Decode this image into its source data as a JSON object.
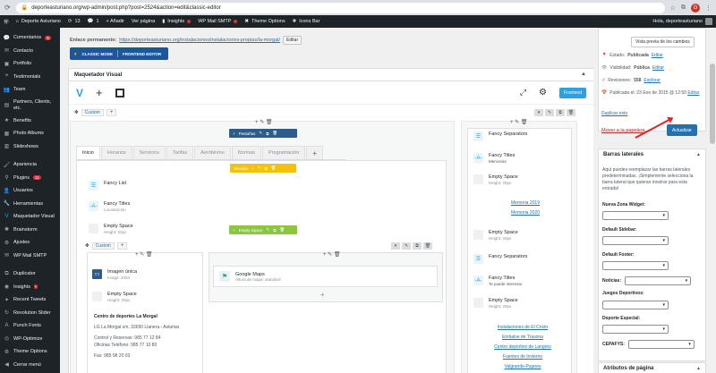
{
  "browser": {
    "url": "deporteasturiano.org/wp-admin/post.php?post=2524&action=edit&classic-editor",
    "avatar_letter": "G"
  },
  "adminbar": {
    "site": "Deporte Asturiano",
    "comments_count": "13",
    "messages_count": "1",
    "new_label": "+ Añadir",
    "view_label": "Ver página",
    "insights_label": "Insights",
    "smtp_label": "WP Mail SMTP",
    "theme_options": "Theme Options",
    "icons_bar": "Icons Bar",
    "hello": "Hola, deporteasturiano"
  },
  "sidebar": {
    "items": [
      {
        "label": "Comentarios",
        "icon": "comment-icon",
        "badge": "9"
      },
      {
        "label": "Contacto",
        "icon": "mail-icon"
      },
      {
        "label": "Portfolio",
        "icon": "portfolio-icon"
      },
      {
        "label": "Testimonials",
        "icon": "quote-icon"
      },
      {
        "label": "Team",
        "icon": "team-icon"
      },
      {
        "label": "Partners, Clients, etc.",
        "icon": "partners-icon"
      },
      {
        "label": "Benefits",
        "icon": "benefits-icon"
      },
      {
        "label": "Photo Albums",
        "icon": "photo-icon"
      },
      {
        "label": "Slideshows",
        "icon": "slides-icon"
      },
      {
        "label": "Apariencia",
        "icon": "brush-icon"
      },
      {
        "label": "Plugins",
        "icon": "plugin-icon",
        "badge": "11"
      },
      {
        "label": "Usuarios",
        "icon": "user-icon"
      },
      {
        "label": "Herramientas",
        "icon": "tools-icon"
      },
      {
        "label": "Maquetador Visual",
        "icon": "vc-icon"
      },
      {
        "label": "Brainstorm",
        "icon": "brain-icon"
      },
      {
        "label": "Ajustes",
        "icon": "settings-icon"
      },
      {
        "label": "WP Mail SMTP",
        "icon": "smtp-icon"
      },
      {
        "label": "Duplicator",
        "icon": "duplicator-icon"
      },
      {
        "label": "Insights",
        "icon": "insights-icon"
      },
      {
        "label": "Recent Tweets",
        "icon": "twitter-icon"
      },
      {
        "label": "Revolution Slider",
        "icon": "slider-icon"
      },
      {
        "label": "Punch Fonts",
        "icon": "font-icon"
      },
      {
        "label": "WP-Optimize",
        "icon": "optimize-icon"
      },
      {
        "label": "Theme Options",
        "icon": "theme-icon"
      },
      {
        "label": "Cerrar menú",
        "icon": "collapse-icon"
      }
    ]
  },
  "editor": {
    "permalink_label": "Enlace permanente:",
    "permalink_url": "https://deporteasturiano.org/instalaciones/instalaciones-propias/la-morgal/",
    "edit_btn": "Editar",
    "classic_mode": "CLASSIC MODE",
    "frontend_editor": "FRONTEND EDITOR",
    "panel_title": "Maquetador Visual",
    "frontend_btn": "Frontend"
  },
  "builder": {
    "row_label": "Custom",
    "tabs_pill": "Pestañas",
    "tabs": [
      "Inicio",
      "Horarios",
      "Servicios",
      "Tarifas",
      "Aeróbinmo",
      "Normas",
      "Programación"
    ],
    "section_pill": "Sección",
    "fancy_list": "Fancy List",
    "fancy_titles": "Fancy Titles",
    "fancy_titles_sub": "Localización",
    "empty_space": "Empty Space",
    "empty_space_sub": "Height: 20px",
    "empty_space_pill": "Empty Space",
    "inner_row_label": "Custom",
    "single_image": "Imagen única",
    "single_image_sub": "Image: 4034",
    "centre_title": "Centro de deportes La Morgal",
    "address": "LG La Morgal s/n. 33690 Llanera - Asturias",
    "phones": "Control y Reservas: 985 77 12 84",
    "offices": "Oficinas Teléfono: 985 77 10 80",
    "fax": "Fax: 985 98 20 03",
    "gmaps": "Google Maps",
    "gmaps_sub": "Altura de mapa: standard",
    "right": {
      "fancy_sep_1": "Fancy Separators",
      "fancy_titles": "Fancy Titles",
      "fancy_titles_sub": "Memorias",
      "empty_space": "Empty Space",
      "empty_space_sub": "Height: 20px",
      "links_1": [
        "Memoria 2019",
        "Memoria 2020"
      ],
      "fancy_sep_2": "Fancy Separators",
      "fancy_titles_2": "Fancy Titles",
      "fancy_titles_2_sub": "Te puede interesar",
      "links_2": [
        "Instalaciones de El Cristo",
        "Embalse de Trasona",
        "Centro deportivo de Langreo",
        "Fuentes de Invierno",
        "Valgrande-Pajares"
      ]
    }
  },
  "publish": {
    "preview": "Vista previa de los cambios",
    "status_label": "Estado:",
    "status_value": "Publicada",
    "visibility_label": "Visibilidad:",
    "visibility_value": "Pública",
    "revisions_label": "Revisiones:",
    "revisions_value": "558",
    "revisions_link": "Explorar",
    "published_label": "Publicada el: 23 Ene de 2015 @ 12:50",
    "edit": "Editar",
    "copy": "Duplicar esto",
    "trash": "Mover a la papelera",
    "update": "Actualizar"
  },
  "sidebars_panel": {
    "title": "Barras laterales",
    "desc": "Aquí puedes reemplazar las barras laterales predeterminadas. ¡Simplemente selecciona la barra lateral que quieras mostrar para esta entrada!",
    "fields": [
      "Nueva Zona Widget:",
      "Default Sidebar:",
      "Default Footer:",
      "Noticias:",
      "Juegos Deportivos:",
      "Deporte Especial:",
      "CEPAFYS:"
    ]
  },
  "attrs_panel": {
    "title": "Atributos de página"
  }
}
